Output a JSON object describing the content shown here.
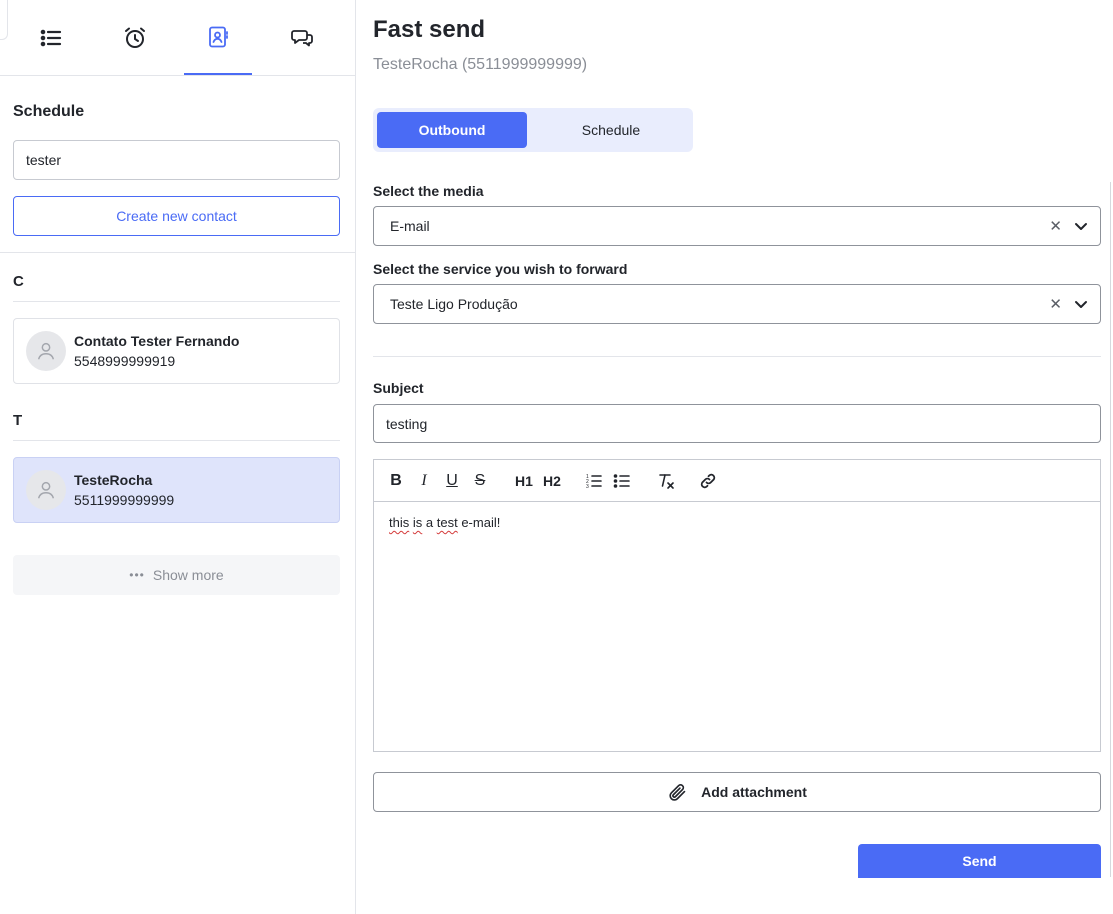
{
  "tabs": [
    {
      "icon": "list-icon"
    },
    {
      "icon": "alarm-clock-icon"
    },
    {
      "icon": "contacts-book-icon",
      "active": true
    },
    {
      "icon": "chat-bubbles-icon"
    }
  ],
  "sidebar": {
    "title": "Schedule",
    "search_value": "tester",
    "create_label": "Create new contact",
    "groups": [
      {
        "letter": "C",
        "contacts": [
          {
            "name": "Contato Tester Fernando",
            "phone": "5548999999919"
          }
        ]
      },
      {
        "letter": "T",
        "contacts": [
          {
            "name": "TesteRocha",
            "phone": "5511999999999",
            "selected": true
          }
        ]
      }
    ],
    "show_more_label": "Show more"
  },
  "main": {
    "title": "Fast send",
    "subtitle": "TesteRocha (5511999999999)",
    "toggle": {
      "outbound": "Outbound",
      "schedule": "Schedule"
    },
    "media_label": "Select the media",
    "media_value": "E-mail",
    "service_label": "Select the service you wish to forward",
    "service_value": "Teste Ligo Produção",
    "subject_label": "Subject",
    "subject_value": "testing",
    "editor": {
      "toolbar": {
        "h1": "H1",
        "h2": "H2"
      },
      "words": [
        "this",
        "is",
        "a",
        "test",
        "e-mail!"
      ]
    },
    "attach_label": "Add attachment",
    "send_label": "Send"
  },
  "colors": {
    "accent": "#4a6bf5",
    "selected_bg": "#dfe4fb",
    "toggle_bg": "#e9edfd"
  }
}
